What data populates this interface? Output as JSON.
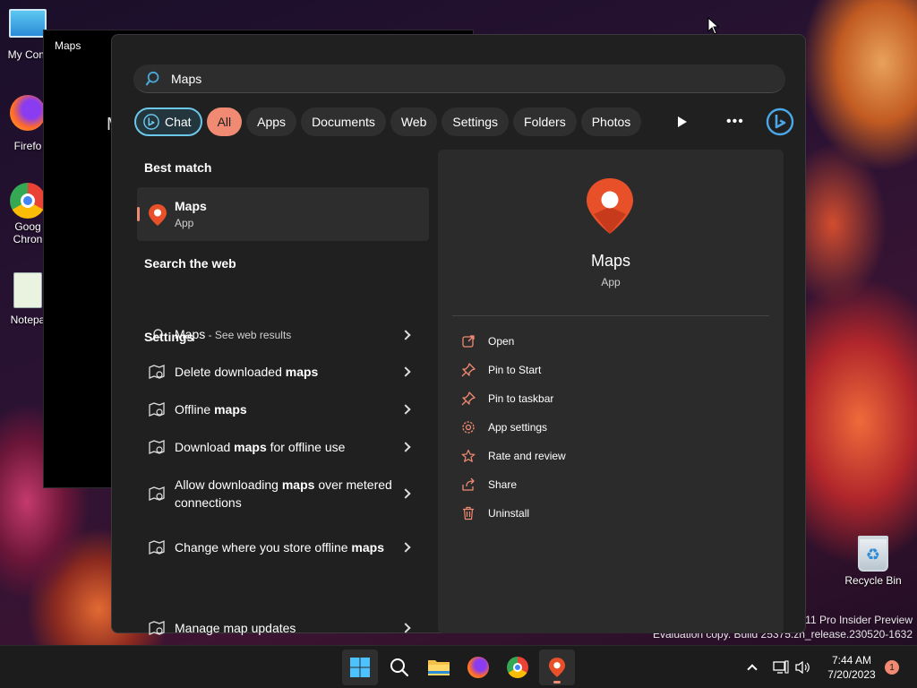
{
  "desktop": {
    "icons": [
      {
        "label": "My Com",
        "name": "my-computer"
      },
      {
        "label": "Firefo",
        "name": "firefox"
      },
      {
        "label": "Goog Chron",
        "name": "google-chrome"
      },
      {
        "label": "Notepa",
        "name": "notepad"
      }
    ],
    "recycle_bin": "Recycle Bin",
    "watermark_line1": "11 Pro Insider Preview",
    "watermark_line2": "Evaluation copy. Build 25375.zn_release.230520-1632"
  },
  "background_window": {
    "title": "Maps",
    "partial_text": "M"
  },
  "search": {
    "query": "Maps",
    "placeholder": ""
  },
  "filters": {
    "chat": "Chat",
    "items": [
      "All",
      "Apps",
      "Documents",
      "Web",
      "Settings",
      "Folders",
      "Photos"
    ],
    "active": "All"
  },
  "results": {
    "best_match_title": "Best match",
    "best_match": {
      "name": "Maps",
      "type": "App"
    },
    "web_title": "Search the web",
    "web_result": {
      "query": "Maps",
      "suffix": " - See web results"
    },
    "settings_title": "Settings",
    "settings": [
      {
        "pre": "Delete downloaded ",
        "bold": "maps",
        "post": ""
      },
      {
        "pre": "Offline ",
        "bold": "maps",
        "post": ""
      },
      {
        "pre": "Download ",
        "bold": "maps",
        "post": " for offline use"
      },
      {
        "pre": "Allow downloading ",
        "bold": "maps",
        "post": " over metered connections"
      },
      {
        "pre": "Change where you store offline ",
        "bold": "maps",
        "post": ""
      },
      {
        "pre": "Manage map updates",
        "bold": "",
        "post": ""
      }
    ]
  },
  "preview": {
    "name": "Maps",
    "type": "App",
    "actions": [
      {
        "label": "Open",
        "icon": "open-external-icon"
      },
      {
        "label": "Pin to Start",
        "icon": "pin-icon"
      },
      {
        "label": "Pin to taskbar",
        "icon": "pin-icon"
      },
      {
        "label": "App settings",
        "icon": "gear-icon"
      },
      {
        "label": "Rate and review",
        "icon": "star-icon"
      },
      {
        "label": "Share",
        "icon": "share-icon"
      },
      {
        "label": "Uninstall",
        "icon": "trash-icon"
      }
    ]
  },
  "taskbar": {
    "time": "7:44 AM",
    "date": "7/20/2023",
    "notification_count": "1"
  },
  "colors": {
    "accent": "#f08a72",
    "chat_border": "#6cc7e8",
    "panel_bg": "#202020",
    "preview_bg": "#2b2b2b"
  }
}
